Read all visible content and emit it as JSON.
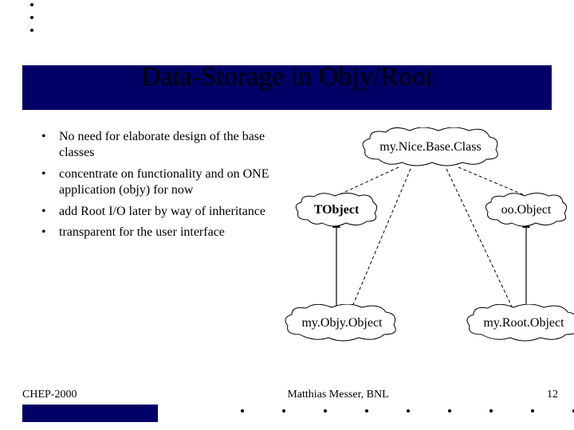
{
  "title": "Data-Storage in Objy/Root",
  "bullets": [
    "No need for elaborate design of the base classes",
    "concentrate on functionality and on ONE application (objy) for now",
    "add Root I/O later by way of inheritance",
    "transparent for the user interface"
  ],
  "diagram": {
    "base_class": "my.Nice.Base.Class",
    "left_parent": "TObject",
    "right_parent": "oo.Object",
    "left_child": "my.Objy.Object",
    "right_child": "my.Root.Object"
  },
  "footer": {
    "venue": "CHEP-2000",
    "author": "Matthias Messer, BNL",
    "page": "12"
  }
}
